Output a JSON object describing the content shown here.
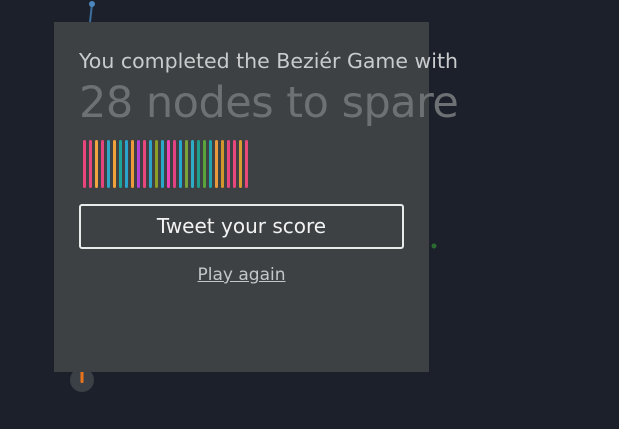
{
  "popup": {
    "headline": "You completed the Beziér Game with",
    "score_text": "28 nodes to spare",
    "tweet_label": "Tweet your score",
    "play_again_label": "Play again"
  },
  "spare_nodes": {
    "count": 28,
    "colors": [
      "#e7457c",
      "#e5467c",
      "#f2a440",
      "#e5457d",
      "#2da7c8",
      "#f2a13a",
      "#1ca59c",
      "#2aa4cb",
      "#ee9a3a",
      "#b53fd2",
      "#e9467e",
      "#2aa2c9",
      "#8c9e26",
      "#2aa7c9",
      "#ee45b6",
      "#e34282",
      "#22a7d2",
      "#7aa43b",
      "#2eaec6",
      "#1e9e8c",
      "#58a43a",
      "#20a4ac",
      "#ea9a3c",
      "#d3962c",
      "#e5457e",
      "#e8467d",
      "#d99b30",
      "#e6497a"
    ]
  },
  "colors": {
    "background": "#1b202b",
    "panel": "#3d4144"
  }
}
